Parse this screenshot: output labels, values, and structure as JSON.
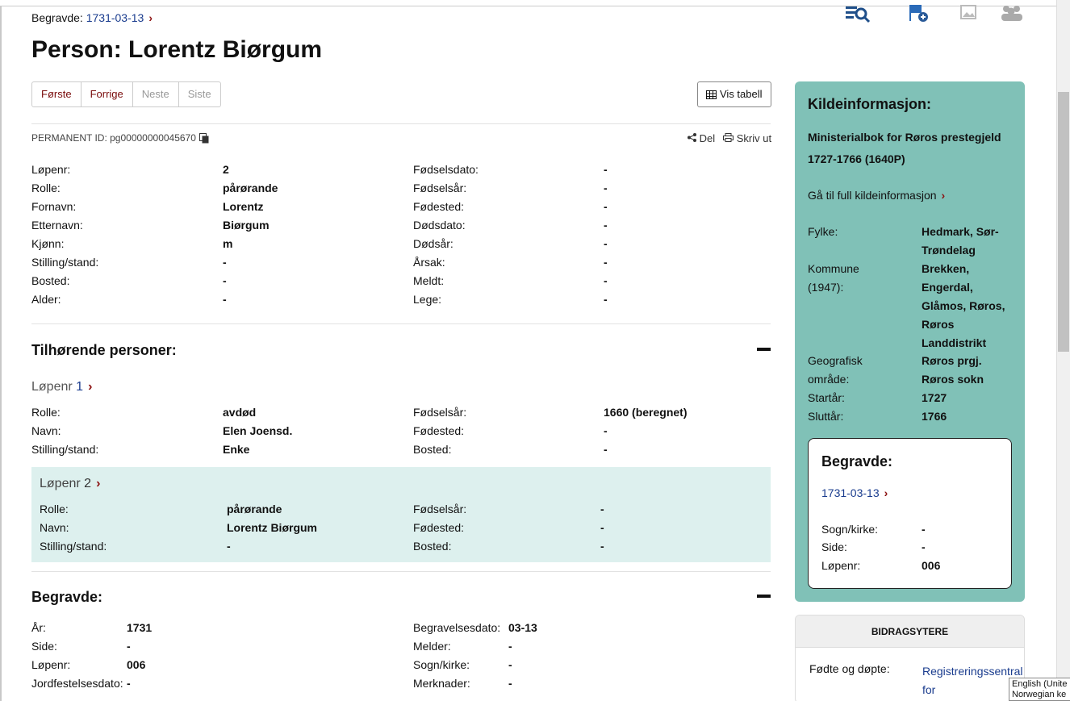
{
  "breadcrumb": {
    "label": "Begravde:",
    "date": "1731-03-13"
  },
  "title": "Person: Lorentz Biørgum",
  "pager": [
    "Første",
    "Forrige",
    "Neste",
    "Siste"
  ],
  "vis_tabell": "Vis tabell",
  "permanent_id": "PERMANENT ID: pg00000000045670",
  "share": {
    "del": "Del",
    "print": "Skriv ut"
  },
  "person": [
    [
      "Løpenr:",
      "2",
      "Fødselsdato:",
      "-"
    ],
    [
      "Rolle:",
      "pårørande",
      "Fødselsår:",
      "-"
    ],
    [
      "Fornavn:",
      "Lorentz",
      "Fødested:",
      "-"
    ],
    [
      "Etternavn:",
      "Biørgum",
      "Dødsdato:",
      "-"
    ],
    [
      "Kjønn:",
      "m",
      "Dødsår:",
      "-"
    ],
    [
      "Stilling/stand:",
      "-",
      "Årsak:",
      "-"
    ],
    [
      "Bosted:",
      "-",
      "Meldt:",
      "-"
    ],
    [
      "Alder:",
      "-",
      "Lege:",
      "-"
    ]
  ],
  "related": {
    "heading": "Tilhørende personer:",
    "p1": {
      "label": "Løpenr",
      "num": "1",
      "rows": [
        [
          "Rolle:",
          "avdød",
          "Fødselsår:",
          "1660 (beregnet)"
        ],
        [
          "Navn:",
          "Elen Joensd.",
          "Fødested:",
          "-"
        ],
        [
          "Stilling/stand:",
          "Enke",
          "Bosted:",
          "-"
        ]
      ]
    },
    "p2": {
      "label": "Løpenr",
      "num": "2",
      "rows": [
        [
          "Rolle:",
          "pårørande",
          "Fødselsår:",
          "-"
        ],
        [
          "Navn:",
          "Lorentz Biørgum",
          "Fødested:",
          "-"
        ],
        [
          "Stilling/stand:",
          "-",
          "Bosted:",
          "-"
        ]
      ]
    }
  },
  "begravde": {
    "heading": "Begravde:",
    "rows": [
      [
        "År:",
        "1731",
        "Begravelsesdato:",
        "03-13"
      ],
      [
        "Side:",
        "-",
        "Melder:",
        "-"
      ],
      [
        "Løpenr:",
        "006",
        "Sogn/kirke:",
        "-"
      ],
      [
        "Jordfestelsesdato:",
        "-",
        "Merknader:",
        "-"
      ]
    ]
  },
  "source": {
    "heading": "Kildeinformasjon:",
    "name": "Ministerialbok for Røros prestegjeld 1727-1766 (1640P)",
    "link": "Gå til full kildeinformasjon",
    "fields": [
      {
        "k": "Fylke:",
        "v": "Hedmark, Sør-Trøndelag"
      },
      {
        "k": "Kommune (1947):",
        "v": "Brekken, Engerdal, Glåmos, Røros, Røros Landdistrikt"
      },
      {
        "k": "Geografisk område:",
        "v": "Røros prgj. Røros sokn"
      },
      {
        "k": "Startår:",
        "v": "1727"
      },
      {
        "k": "Sluttår:",
        "v": "1766"
      }
    ]
  },
  "begravde_card": {
    "heading": "Begravde:",
    "date": "1731-03-13",
    "fields": [
      {
        "k": "Sogn/kirke:",
        "v": "-"
      },
      {
        "k": "Side:",
        "v": "-"
      },
      {
        "k": "Løpenr:",
        "v": "006"
      }
    ]
  },
  "contributors": {
    "heading": "BIDRAGSYTERE",
    "k": "Fødte og døpte:",
    "v": "Registreringssentral for"
  },
  "language_tip": {
    "line1": "English (Unite",
    "line2": "Norwegian ke"
  },
  "colors": {
    "sidebar": "#80c1b7",
    "highlight": "#ddf0ee",
    "accent": "#7a0c0c",
    "link": "#1a3c8e"
  }
}
